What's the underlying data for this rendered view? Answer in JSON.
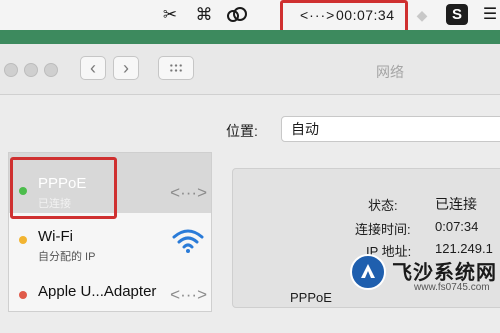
{
  "menubar": {
    "vpn_icon": "<···>",
    "clock": "00:07:34",
    "s_badge": "S"
  },
  "window": {
    "title": "网络",
    "back": "‹",
    "forward": "›"
  },
  "location": {
    "label": "位置:",
    "value": "自动"
  },
  "services": [
    {
      "name": "PPPoE",
      "status": "已连接",
      "dot_color": "#4cbd4c",
      "icon": "<···>"
    },
    {
      "name": "Wi-Fi",
      "status": "自分配的 IP",
      "dot_color": "#f2b431",
      "icon": "wifi-icon"
    },
    {
      "name": "Apple U...Adapter",
      "status": "",
      "dot_color": "#e05a4a",
      "icon": "<···>"
    }
  ],
  "detail": {
    "status_label": "状态:",
    "status_value": "已连接",
    "time_label": "连接时间:",
    "time_value": "0:07:34",
    "ip_label": "IP 地址:",
    "ip_value": "121.249.1",
    "pppoe_label": "PPPoE"
  },
  "watermark": {
    "text": "飞沙系统网",
    "url": "www.fs0745.com"
  },
  "colors": {
    "highlight_red": "#cf3030",
    "green_strip": "#3d8a5e"
  }
}
